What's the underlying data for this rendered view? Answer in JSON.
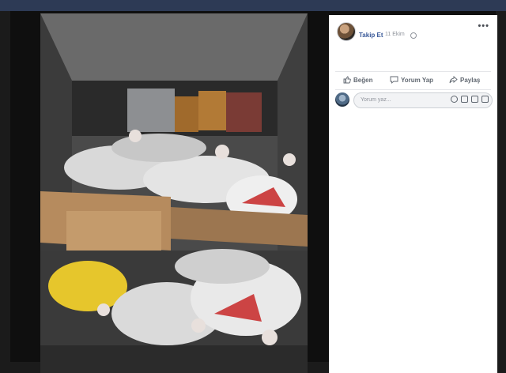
{
  "post": {
    "author": "Takip Et",
    "date": "11 Ekim",
    "more_icon": "ellipsis-icon",
    "privacy_icon": "globe-icon"
  },
  "actions": [
    {
      "label": "Beğen",
      "icon": "thumbs-up-icon"
    },
    {
      "label": "Yorum Yap",
      "icon": "comment-icon"
    },
    {
      "label": "Paylaş",
      "icon": "share-icon"
    }
  ],
  "composer": {
    "placeholder": "Yorum yaz...",
    "icons": [
      "emoji-icon",
      "camera-icon",
      "gif-icon",
      "sticker-icon"
    ]
  },
  "colors": {
    "link": "#385898",
    "muted": "#90949c",
    "topbar": "#2d3a55"
  }
}
